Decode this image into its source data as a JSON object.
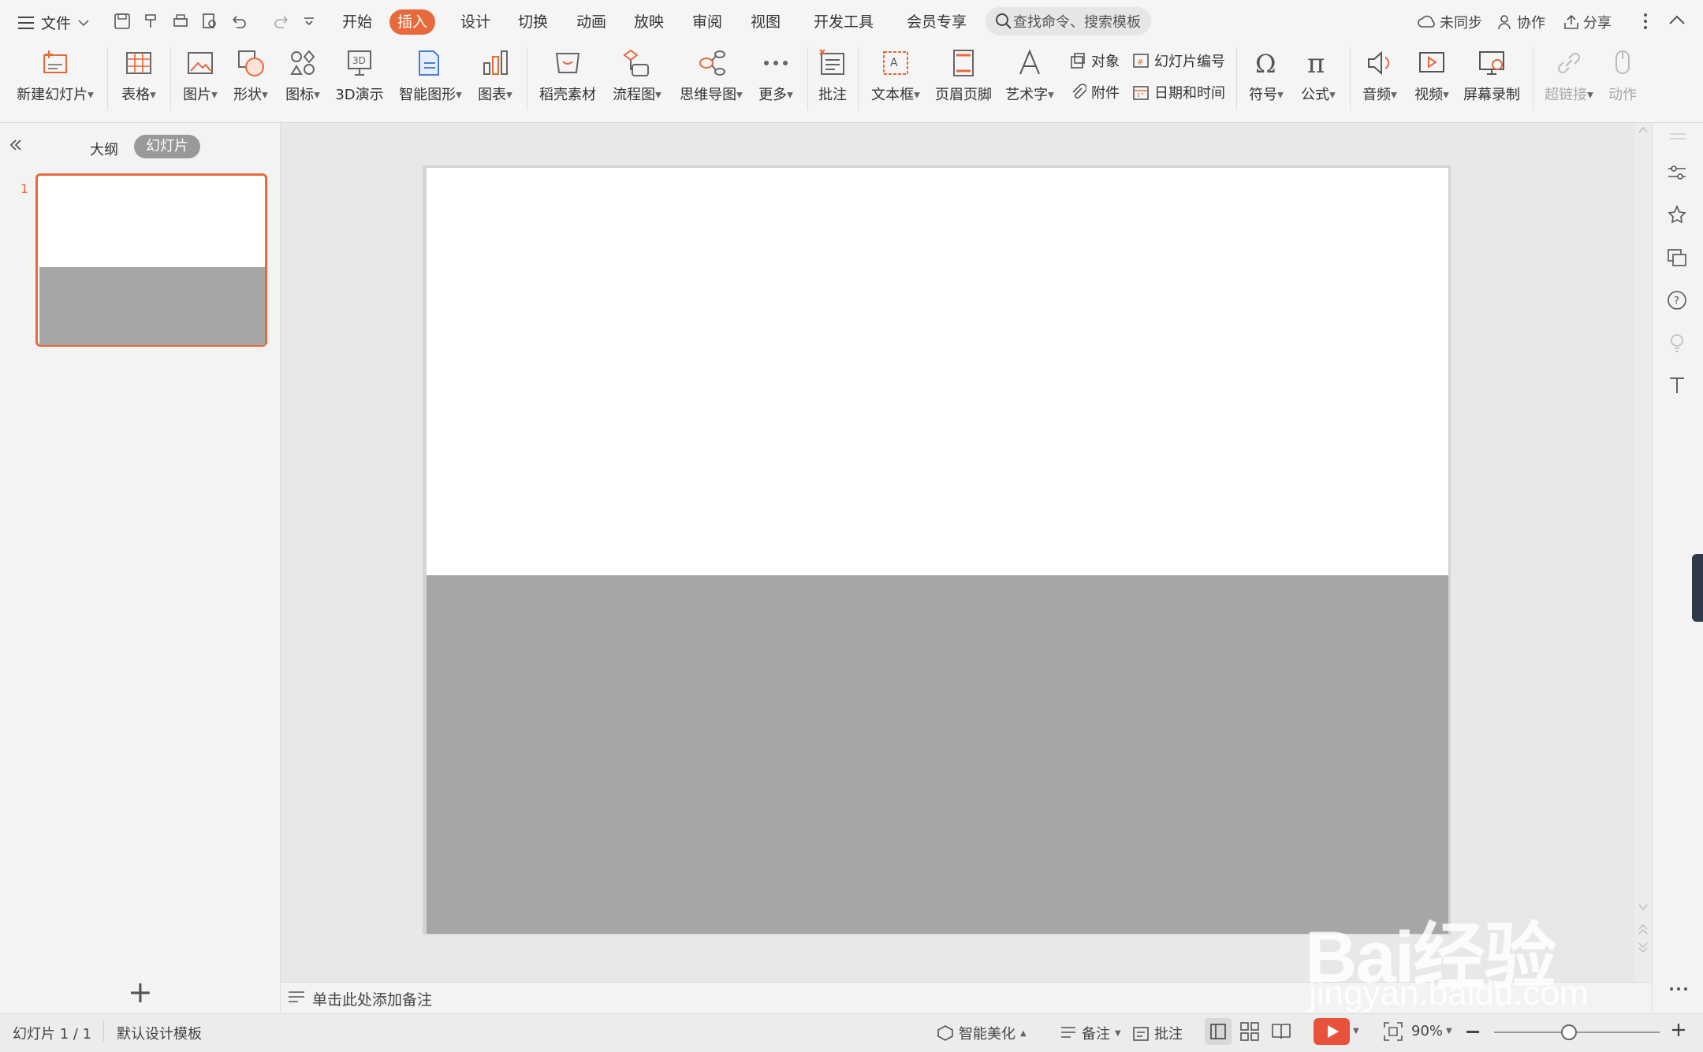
{
  "menu": {
    "file_label": "文件",
    "tabs": [
      "开始",
      "插入",
      "设计",
      "切换",
      "动画",
      "放映",
      "审阅",
      "视图",
      "开发工具",
      "会员专享"
    ],
    "active_tab": "插入",
    "search_placeholder": "查找命令、搜索模板",
    "sync_label": "未同步",
    "collab_label": "协作",
    "share_label": "分享"
  },
  "ribbon": {
    "new_slide": "新建幻灯片",
    "table": "表格",
    "picture": "图片",
    "shape": "形状",
    "icon": "图标",
    "demo3d": "3D演示",
    "smart_graphic": "智能图形",
    "chart": "图表",
    "daoke": "稻壳素材",
    "flowchart": "流程图",
    "mindmap": "思维导图",
    "more": "更多",
    "comment": "批注",
    "textbox": "文本框",
    "header_footer": "页眉页脚",
    "wordart": "艺术字",
    "object": "对象",
    "slide_number": "幻灯片编号",
    "attachment": "附件",
    "datetime": "日期和时间",
    "symbol": "符号",
    "formula": "公式",
    "audio": "音频",
    "video": "视频",
    "screen_record": "屏幕录制",
    "hyperlink": "超链接",
    "action": "动作"
  },
  "left_panel": {
    "outline_tab": "大纲",
    "slides_tab": "幻灯片",
    "slide_number": "1",
    "add_label": "+"
  },
  "notes": {
    "placeholder": "单击此处添加备注"
  },
  "status": {
    "slide_info": "幻灯片 1 / 1",
    "template": "默认设计模板",
    "beautify": "智能美化",
    "notes": "备注",
    "comments": "批注",
    "zoom": "90%",
    "zoom_level": 0.45
  },
  "watermark": {
    "brand": "Bai经验",
    "url": "jingyan.baidu.com"
  },
  "colors": {
    "accent": "#e8693b",
    "slide_gray": "#a6a6a6",
    "play": "#e8513b"
  }
}
